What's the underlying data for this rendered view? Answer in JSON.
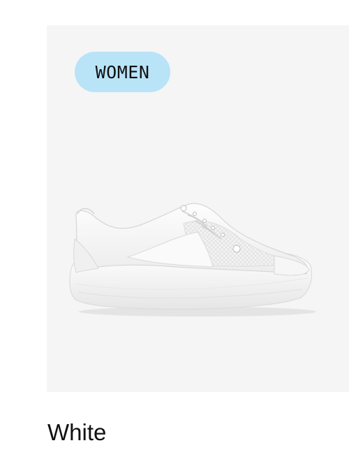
{
  "product": {
    "badge": "WOMEN",
    "color_name": "White",
    "image_icon": "white-sneaker-image",
    "colors": {
      "panel_background": "#f5f5f5",
      "badge_background": "#b9e4f8",
      "text": "#111111"
    }
  }
}
